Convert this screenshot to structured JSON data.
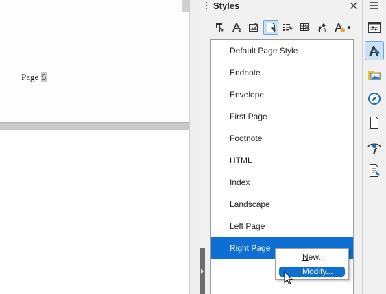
{
  "document": {
    "page_label": "Page ",
    "page_number": "5"
  },
  "styles_panel": {
    "title": "Styles",
    "close_icon": "close-icon",
    "toolbar": [
      {
        "name": "paragraph-styles-icon",
        "active": false
      },
      {
        "name": "character-styles-icon",
        "active": false
      },
      {
        "name": "frame-styles-icon",
        "active": false
      },
      {
        "name": "page-styles-icon",
        "active": true
      },
      {
        "name": "list-styles-icon",
        "active": false
      },
      {
        "name": "table-styles-icon",
        "active": false
      },
      {
        "name": "fill-format-mode-icon",
        "active": false
      },
      {
        "name": "styles-actions-icon",
        "active": false
      }
    ],
    "items": [
      {
        "label": "Default Page Style"
      },
      {
        "label": "Endnote"
      },
      {
        "label": "Envelope"
      },
      {
        "label": "First Page"
      },
      {
        "label": "Footnote"
      },
      {
        "label": "HTML"
      },
      {
        "label": "Index"
      },
      {
        "label": "Landscape"
      },
      {
        "label": "Left Page"
      },
      {
        "label": "Right Page",
        "selected": true
      }
    ]
  },
  "context_menu": {
    "new_label": "New...",
    "new_mnemonic": "N",
    "new_rest": "ew...",
    "modify_label": "Modify...",
    "modify_mnemonic": "M",
    "modify_rest": "odify..."
  },
  "sidebar": {
    "menu_icon": "hamburger-menu-icon",
    "tabs": [
      {
        "name": "properties-icon"
      },
      {
        "name": "styles-icon",
        "active": true
      },
      {
        "name": "gallery-icon"
      },
      {
        "name": "navigator-icon"
      },
      {
        "name": "page-icon"
      },
      {
        "name": "style-inspector-icon"
      },
      {
        "name": "manage-changes-icon"
      }
    ]
  },
  "colors": {
    "selection": "#0e6fd2",
    "active_tab": "#c9e0f5"
  }
}
